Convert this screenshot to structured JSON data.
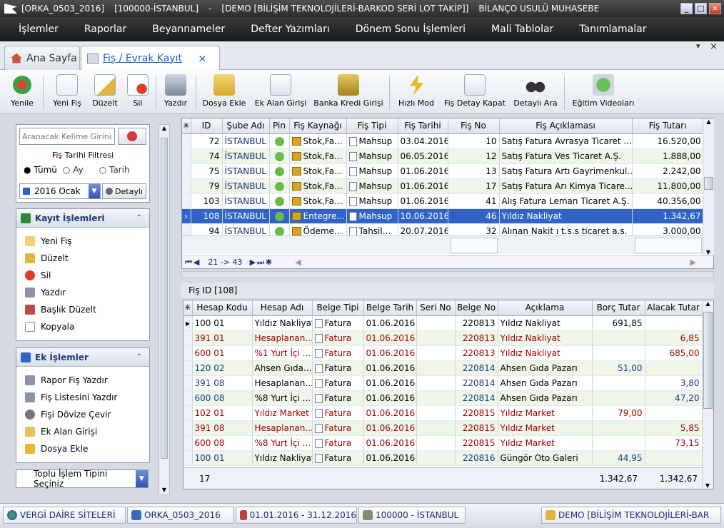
{
  "window": {
    "title_parts": [
      "[ORKA_0503_2016]",
      "[100000-İSTANBUL]",
      "-",
      "[DEMO [BİLİŞİM TEKNOLOJİLERİ-BARKOD SERİ LOT TAKİP]]",
      "BİLANÇO USULÜ MUHASEBE"
    ],
    "minimize": "_",
    "maximize": "□",
    "close": "×"
  },
  "menu": [
    "İşlemler",
    "Raporlar",
    "Beyannameler",
    "Defter Yazımları",
    "Dönem Sonu İşlemleri",
    "Mali Tablolar",
    "Tanımlamalar"
  ],
  "tabs": {
    "home": "Ana Sayfa",
    "active": "Fiş / Evrak Kayıt",
    "close": "×",
    "pin": "▾",
    "close_all": "×"
  },
  "toolbar": [
    "Yenile",
    "Yeni Fiş",
    "Düzelt",
    "Sil",
    "Yazdır",
    "Dosya Ekle",
    "Ek Alan Girişi",
    "Banka Kredi Girişi",
    "Hızlı Mod",
    "Fiş Detay Kapat",
    "Detaylı Ara",
    "Eğitim Videoları"
  ],
  "left": {
    "search_placeholder": "Aranacak Kelime Giriniz",
    "filter_title": "Fiş Tarihi Filtresi",
    "radios": [
      "Tümü",
      "Ay",
      "Tarih"
    ],
    "month_select": "2016 Ocak",
    "detail_button": "Detaylı",
    "kayit_title": "Kayıt İşlemleri",
    "kayit_items": [
      "Yeni Fiş",
      "Düzelt",
      "Sil",
      "Yazdır",
      "Başlık Düzelt",
      "Kopyala"
    ],
    "ek_title": "Ek İşlemler",
    "ek_items": [
      "Rapor Fiş Yazdır",
      "Fiş Listesini Yazdır",
      "Fişi Dövize Çevir",
      "Ek Alan Girişi",
      "Dosya Ekle"
    ],
    "bulk_select": "Toplu İşlem Tipini Seçiniz",
    "collapse": "«"
  },
  "top_grid": {
    "columns": [
      "ID",
      "Şube Adı",
      "Pin",
      "Fiş Kaynağı",
      "Fiş Tipi",
      "Fiş Tarihi",
      "Fiş No",
      "Fiş Açıklaması",
      "Fiş Tutarı"
    ],
    "rows": [
      {
        "id": "72",
        "sube": "İSTANBUL",
        "kaynak": "Stok,Fa...",
        "tip": "Mahsup",
        "tarih": "03.04.2016",
        "no": "10",
        "aciklama": "Satış Fatura Avrasya Ticaret ...",
        "tutar": "16.520,00"
      },
      {
        "id": "74",
        "sube": "İSTANBUL",
        "kaynak": "Stok,Fa...",
        "tip": "Mahsup",
        "tarih": "06.05.2016",
        "no": "12",
        "aciklama": "Satış Fatura Ves Ticaret A.Ş.",
        "tutar": "1.888,00"
      },
      {
        "id": "75",
        "sube": "İSTANBUL",
        "kaynak": "Stok,Fa...",
        "tip": "Mahsup",
        "tarih": "01.06.2016",
        "no": "13",
        "aciklama": "Satış Fatura Artı Gayrimenkul...",
        "tutar": "2.242,00"
      },
      {
        "id": "79",
        "sube": "İSTANBUL",
        "kaynak": "Stok,Fa...",
        "tip": "Mahsup",
        "tarih": "01.06.2016",
        "no": "17",
        "aciklama": "Satış Fatura Arı Kimya Ticare...",
        "tutar": "11.800,00"
      },
      {
        "id": "103",
        "sube": "İSTANBUL",
        "kaynak": "Stok,Fa...",
        "tip": "Mahsup",
        "tarih": "01.06.2016",
        "no": "41",
        "aciklama": "Alış Fatura Leman Ticaret A.Ş.",
        "tutar": "40.356,00"
      },
      {
        "id": "108",
        "sube": "İSTANBUL",
        "kaynak": "Entegre...",
        "tip": "Mahsup",
        "tarih": "10.06.2016",
        "no": "46",
        "aciklama": "Yıldız Nakliyat",
        "tutar": "1.342,67"
      },
      {
        "id": "94",
        "sube": "İSTANBUL",
        "kaynak": "Ödeme...",
        "tip": "Tahsil...",
        "tarih": "20.07.2016",
        "no": "32",
        "aciklama": "Alınan Nakit ı t.s.s ticaret a.s.",
        "tutar": "3.000,00"
      }
    ],
    "nav": "21 -> 43"
  },
  "detail_header": "Fiş ID [108]",
  "bottom_grid": {
    "columns": [
      "Hesap Kodu",
      "Hesap Adı",
      "Belge Tipi",
      "Belge Tarih",
      "Seri No",
      "Belge No",
      "Açıklama",
      "Borç Tutar",
      "Alacak Tutar"
    ],
    "rows": [
      {
        "kod": "100 01",
        "adi": "Yıldız Nakliyat",
        "tip": "Fatura",
        "tarih": "01.06.2016",
        "seri": "",
        "no": "220813",
        "aciklama": "Yıldız Nakliyat",
        "borc": "691,85",
        "alacak": "",
        "color": "black"
      },
      {
        "kod": "391 01",
        "adi": "Hesaplanan...",
        "tip": "Fatura",
        "tarih": "01.06.2016",
        "seri": "",
        "no": "220813",
        "aciklama": "Yıldız Nakliyat",
        "borc": "",
        "alacak": "6,85",
        "color": "red"
      },
      {
        "kod": "600 01",
        "adi": "%1 Yurt İçi ...",
        "tip": "Fatura",
        "tarih": "01.06.2016",
        "seri": "",
        "no": "220813",
        "aciklama": "Yıldız Nakliyat",
        "borc": "",
        "alacak": "685,00",
        "color": "red"
      },
      {
        "kod": "120 02",
        "adi": "Ahsen Gıda...",
        "tip": "Fatura",
        "tarih": "01.06.2016",
        "seri": "",
        "no": "220814",
        "aciklama": "Ahsen Gıda Pazarı",
        "borc": "51,00",
        "alacak": "",
        "color": "blue"
      },
      {
        "kod": "391 08",
        "adi": "Hesaplanan...",
        "tip": "Fatura",
        "tarih": "01.06.2016",
        "seri": "",
        "no": "220814",
        "aciklama": "Ahsen Gıda Pazarı",
        "borc": "",
        "alacak": "3,80",
        "color": "blue"
      },
      {
        "kod": "600 08",
        "adi": "%8 Yurt İçi ...",
        "tip": "Fatura",
        "tarih": "01.06.2016",
        "seri": "",
        "no": "220814",
        "aciklama": "Ahsen Gıda Pazarı",
        "borc": "",
        "alacak": "47,20",
        "color": "blue"
      },
      {
        "kod": "102 01",
        "adi": "Yıldız Market",
        "tip": "Fatura",
        "tarih": "01.06.2016",
        "seri": "",
        "no": "220815",
        "aciklama": "Yıldız Market",
        "borc": "79,00",
        "alacak": "",
        "color": "red"
      },
      {
        "kod": "391 08",
        "adi": "Hesaplanan...",
        "tip": "Fatura",
        "tarih": "01.06.2016",
        "seri": "",
        "no": "220815",
        "aciklama": "Yıldız Market",
        "borc": "",
        "alacak": "5,85",
        "color": "red"
      },
      {
        "kod": "600 08",
        "adi": "%8 Yurt İçi ...",
        "tip": "Fatura",
        "tarih": "01.06.2016",
        "seri": "",
        "no": "220815",
        "aciklama": "Yıldız Market",
        "borc": "",
        "alacak": "73,15",
        "color": "red"
      },
      {
        "kod": "100 01",
        "adi": "Yıldız Nakliyat",
        "tip": "Fatura",
        "tarih": "01.06.2016",
        "seri": "",
        "no": "220816",
        "aciklama": "Güngör Oto Galeri",
        "borc": "44,95",
        "alacak": "",
        "color": "blue"
      }
    ],
    "footer": {
      "count": "17",
      "borc_total": "1.342,67",
      "alacak_total": "1.342,67"
    }
  },
  "statusbar": [
    "VERGİ DAİRE SİTELERİ",
    "ORKA_0503_2016",
    "01.01.2016 - 31.12.2016",
    "100000 - İSTANBUL",
    "DEMO [BİLİŞİM TEKNOLOJİLERİ-BAR"
  ]
}
